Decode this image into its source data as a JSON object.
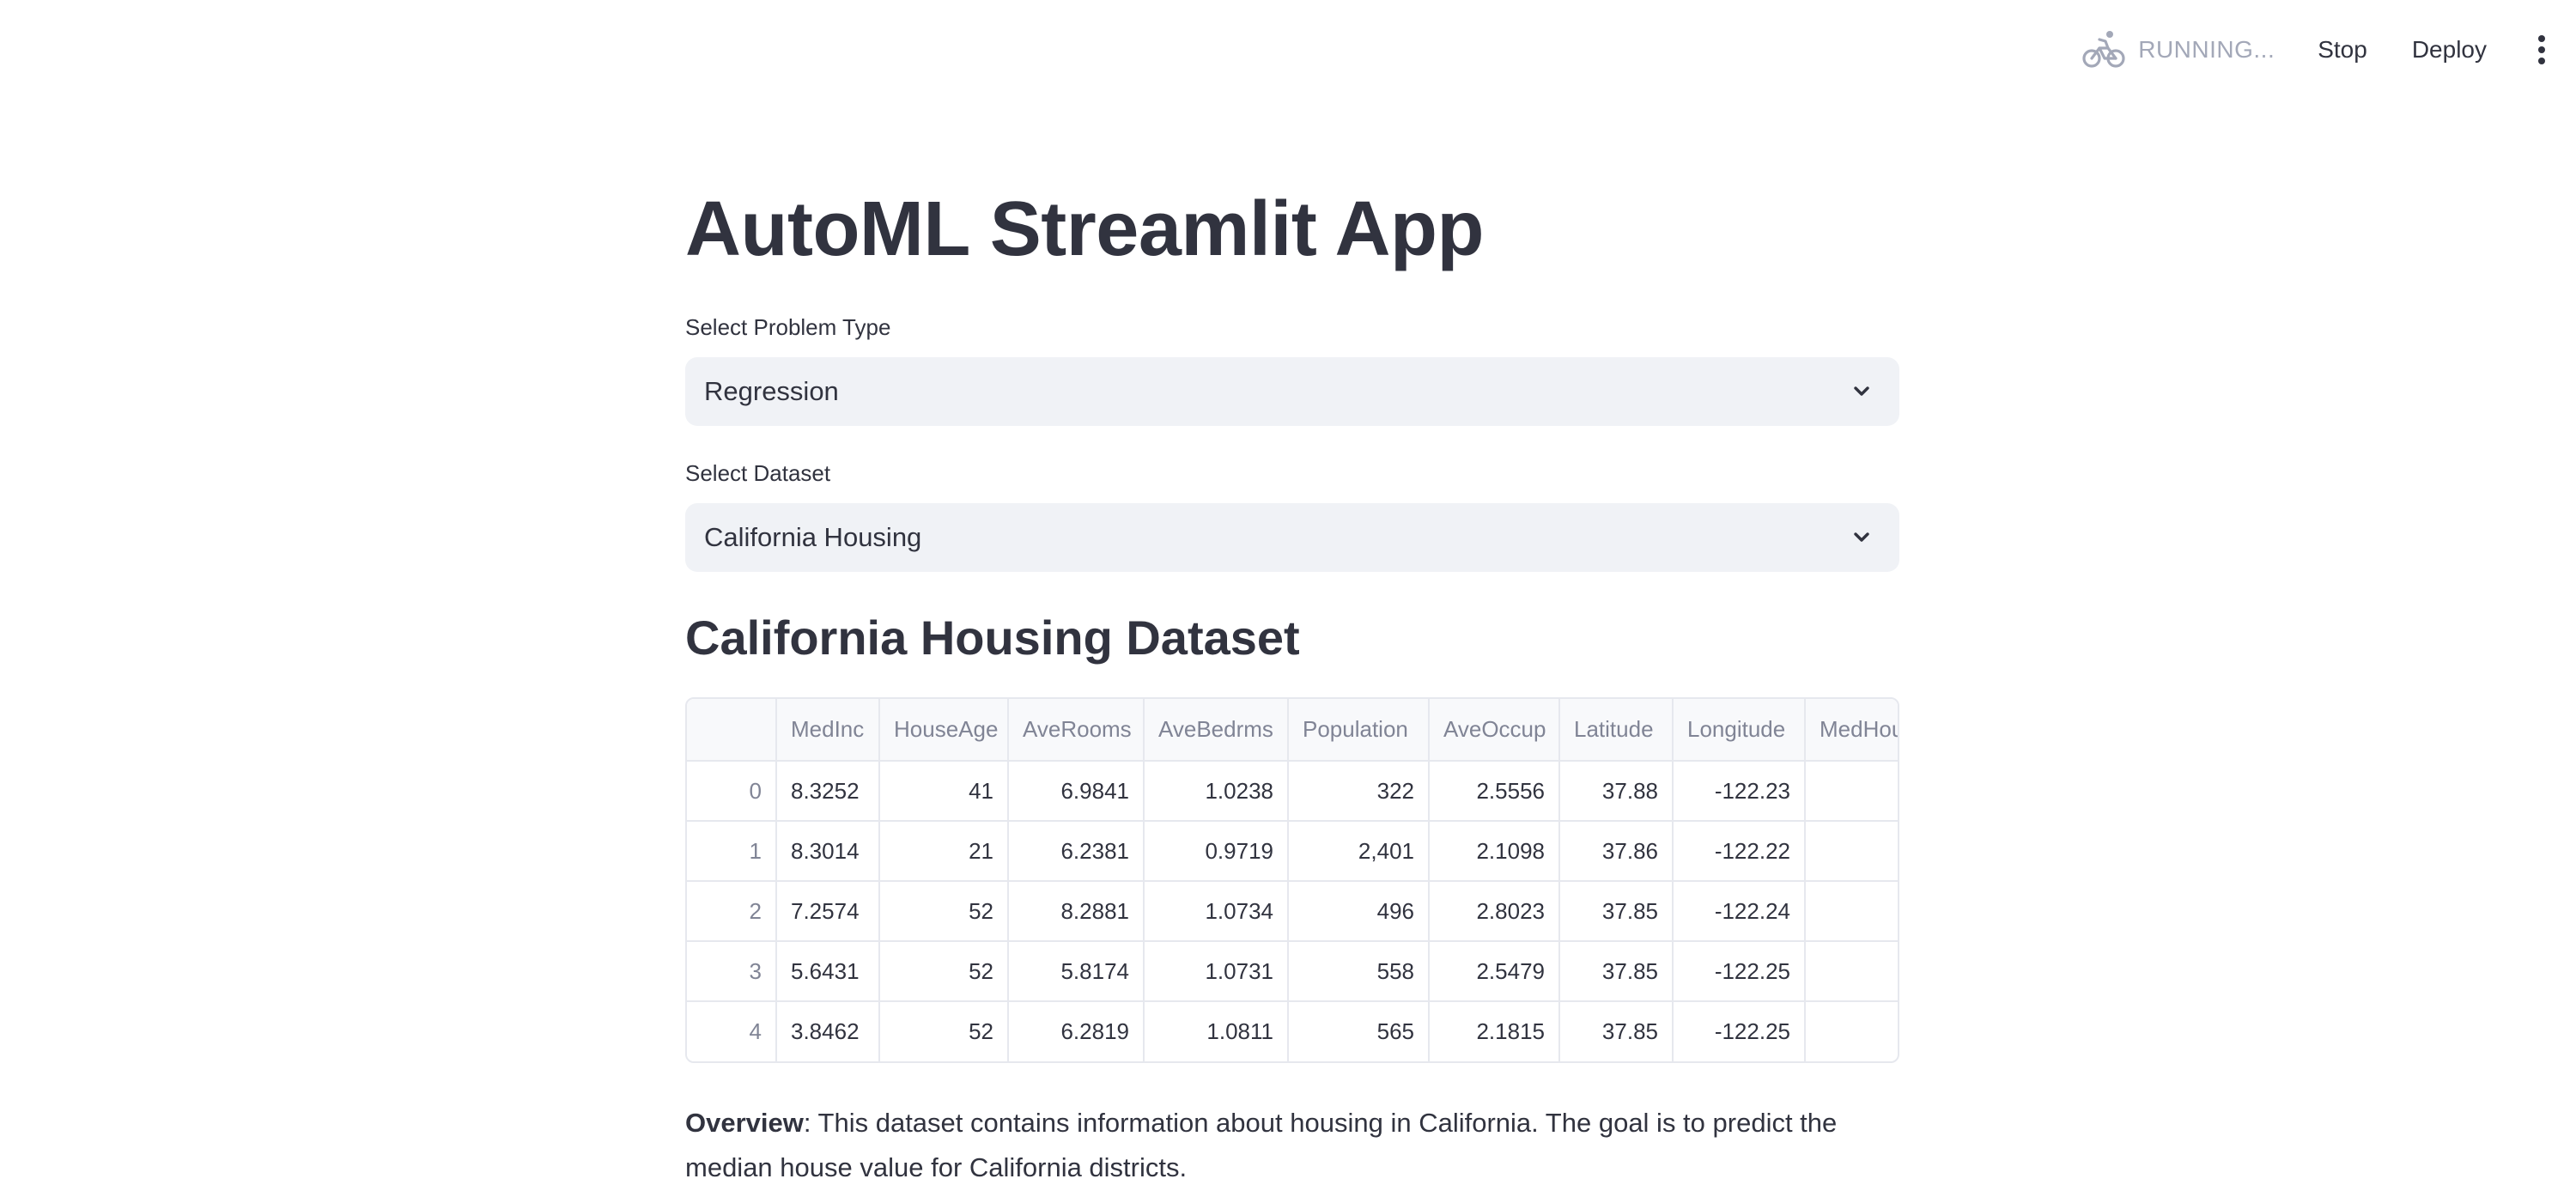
{
  "header": {
    "status_text": "RUNNING...",
    "status_icon": "running-cyclist-icon",
    "stop_label": "Stop",
    "deploy_label": "Deploy",
    "menu_icon": "kebab-menu-icon"
  },
  "main": {
    "title": "AutoML Streamlit App",
    "problem_type": {
      "label": "Select Problem Type",
      "value": "Regression"
    },
    "dataset": {
      "label": "Select Dataset",
      "value": "California Housing"
    },
    "section_title": "California Housing Dataset",
    "table": {
      "columns": [
        "",
        "MedInc",
        "HouseAge",
        "AveRooms",
        "AveBedrms",
        "Population",
        "AveOccup",
        "Latitude",
        "Longitude",
        "MedHouseVal"
      ],
      "rows": [
        {
          "index": "0",
          "cells": [
            "8.3252",
            "41",
            "6.9841",
            "1.0238",
            "322",
            "2.5556",
            "37.88",
            "-122.23",
            ""
          ]
        },
        {
          "index": "1",
          "cells": [
            "8.3014",
            "21",
            "6.2381",
            "0.9719",
            "2,401",
            "2.1098",
            "37.86",
            "-122.22",
            ""
          ]
        },
        {
          "index": "2",
          "cells": [
            "7.2574",
            "52",
            "8.2881",
            "1.0734",
            "496",
            "2.8023",
            "37.85",
            "-122.24",
            ""
          ]
        },
        {
          "index": "3",
          "cells": [
            "5.6431",
            "52",
            "5.8174",
            "1.0731",
            "558",
            "2.5479",
            "37.85",
            "-122.25",
            ""
          ]
        },
        {
          "index": "4",
          "cells": [
            "3.8462",
            "52",
            "6.2819",
            "1.0811",
            "565",
            "2.1815",
            "37.85",
            "-122.25",
            ""
          ]
        }
      ]
    },
    "overview": {
      "label": "Overview",
      "text": ": This dataset contains information about housing in California. The goal is to predict the median house value for California districts."
    }
  },
  "colors": {
    "text": "#31333f",
    "muted": "#808495",
    "select_bg": "#f0f2f6",
    "border": "#e6e8ee",
    "status": "#a3a8b8"
  }
}
